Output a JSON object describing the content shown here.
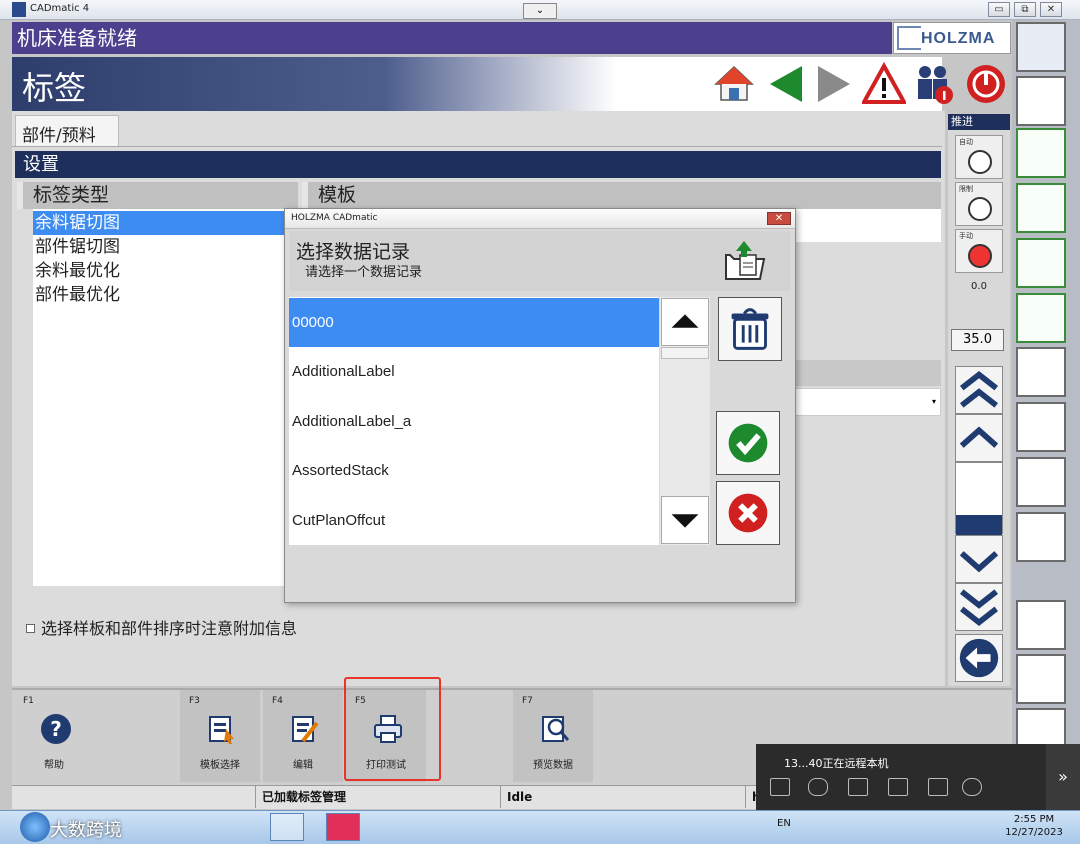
{
  "window": {
    "title": "CADmatic 4",
    "minimize": "▭",
    "restore": "⧉",
    "close": "✕",
    "dropdown": "⌄"
  },
  "status": {
    "text": "机床准备就绪"
  },
  "brand": {
    "logo_text": "HOLZMA"
  },
  "page": {
    "title": "标签"
  },
  "tabs": [
    {
      "label": "部件/预料"
    }
  ],
  "settings": {
    "label": "设置"
  },
  "columns": {
    "label_type": "标签类型",
    "template": "模板"
  },
  "label_types": [
    "余料锯切图",
    "部件锯切图",
    "余料最优化",
    "部件最优化"
  ],
  "options": {
    "notice_text": "选择样板和部件排序时注意附加信息"
  },
  "dialog": {
    "title": "HOLZMA CADmatic",
    "heading": "选择数据记录",
    "subheading": "请选择一个数据记录",
    "records": [
      "00000",
      "AdditionalLabel",
      "AdditionalLabel_a",
      "AssortedStack",
      "CutPlanOffcut"
    ]
  },
  "push_panel": {
    "header": "推进",
    "modes": [
      {
        "label": "自动"
      },
      {
        "label": "限制"
      },
      {
        "label": "手动"
      }
    ],
    "speed_readout": "0.0",
    "speed_value": "35.0"
  },
  "function_keys": [
    {
      "key": "F1",
      "label": "帮助"
    },
    {
      "key": "F3",
      "label": "模板选择"
    },
    {
      "key": "F4",
      "label": "编辑"
    },
    {
      "key": "F5",
      "label": "打印测试"
    },
    {
      "key": "F7",
      "label": "预览数据"
    }
  ],
  "statusline": {
    "message": "已加载标签管理",
    "state": "Idle",
    "extra": "h"
  },
  "remote_popup": {
    "text": "13...40正在远程本机",
    "more": "»"
  },
  "taskbar": {
    "language": "EN",
    "time": "2:55 PM",
    "date": "12/27/2023",
    "watermark": "大数跨境"
  },
  "colors": {
    "accent_blue": "#3d8cf2",
    "header_navy": "#1f2f5c",
    "status_purple": "#4b3f8e",
    "highlight_red": "#e8322c"
  }
}
